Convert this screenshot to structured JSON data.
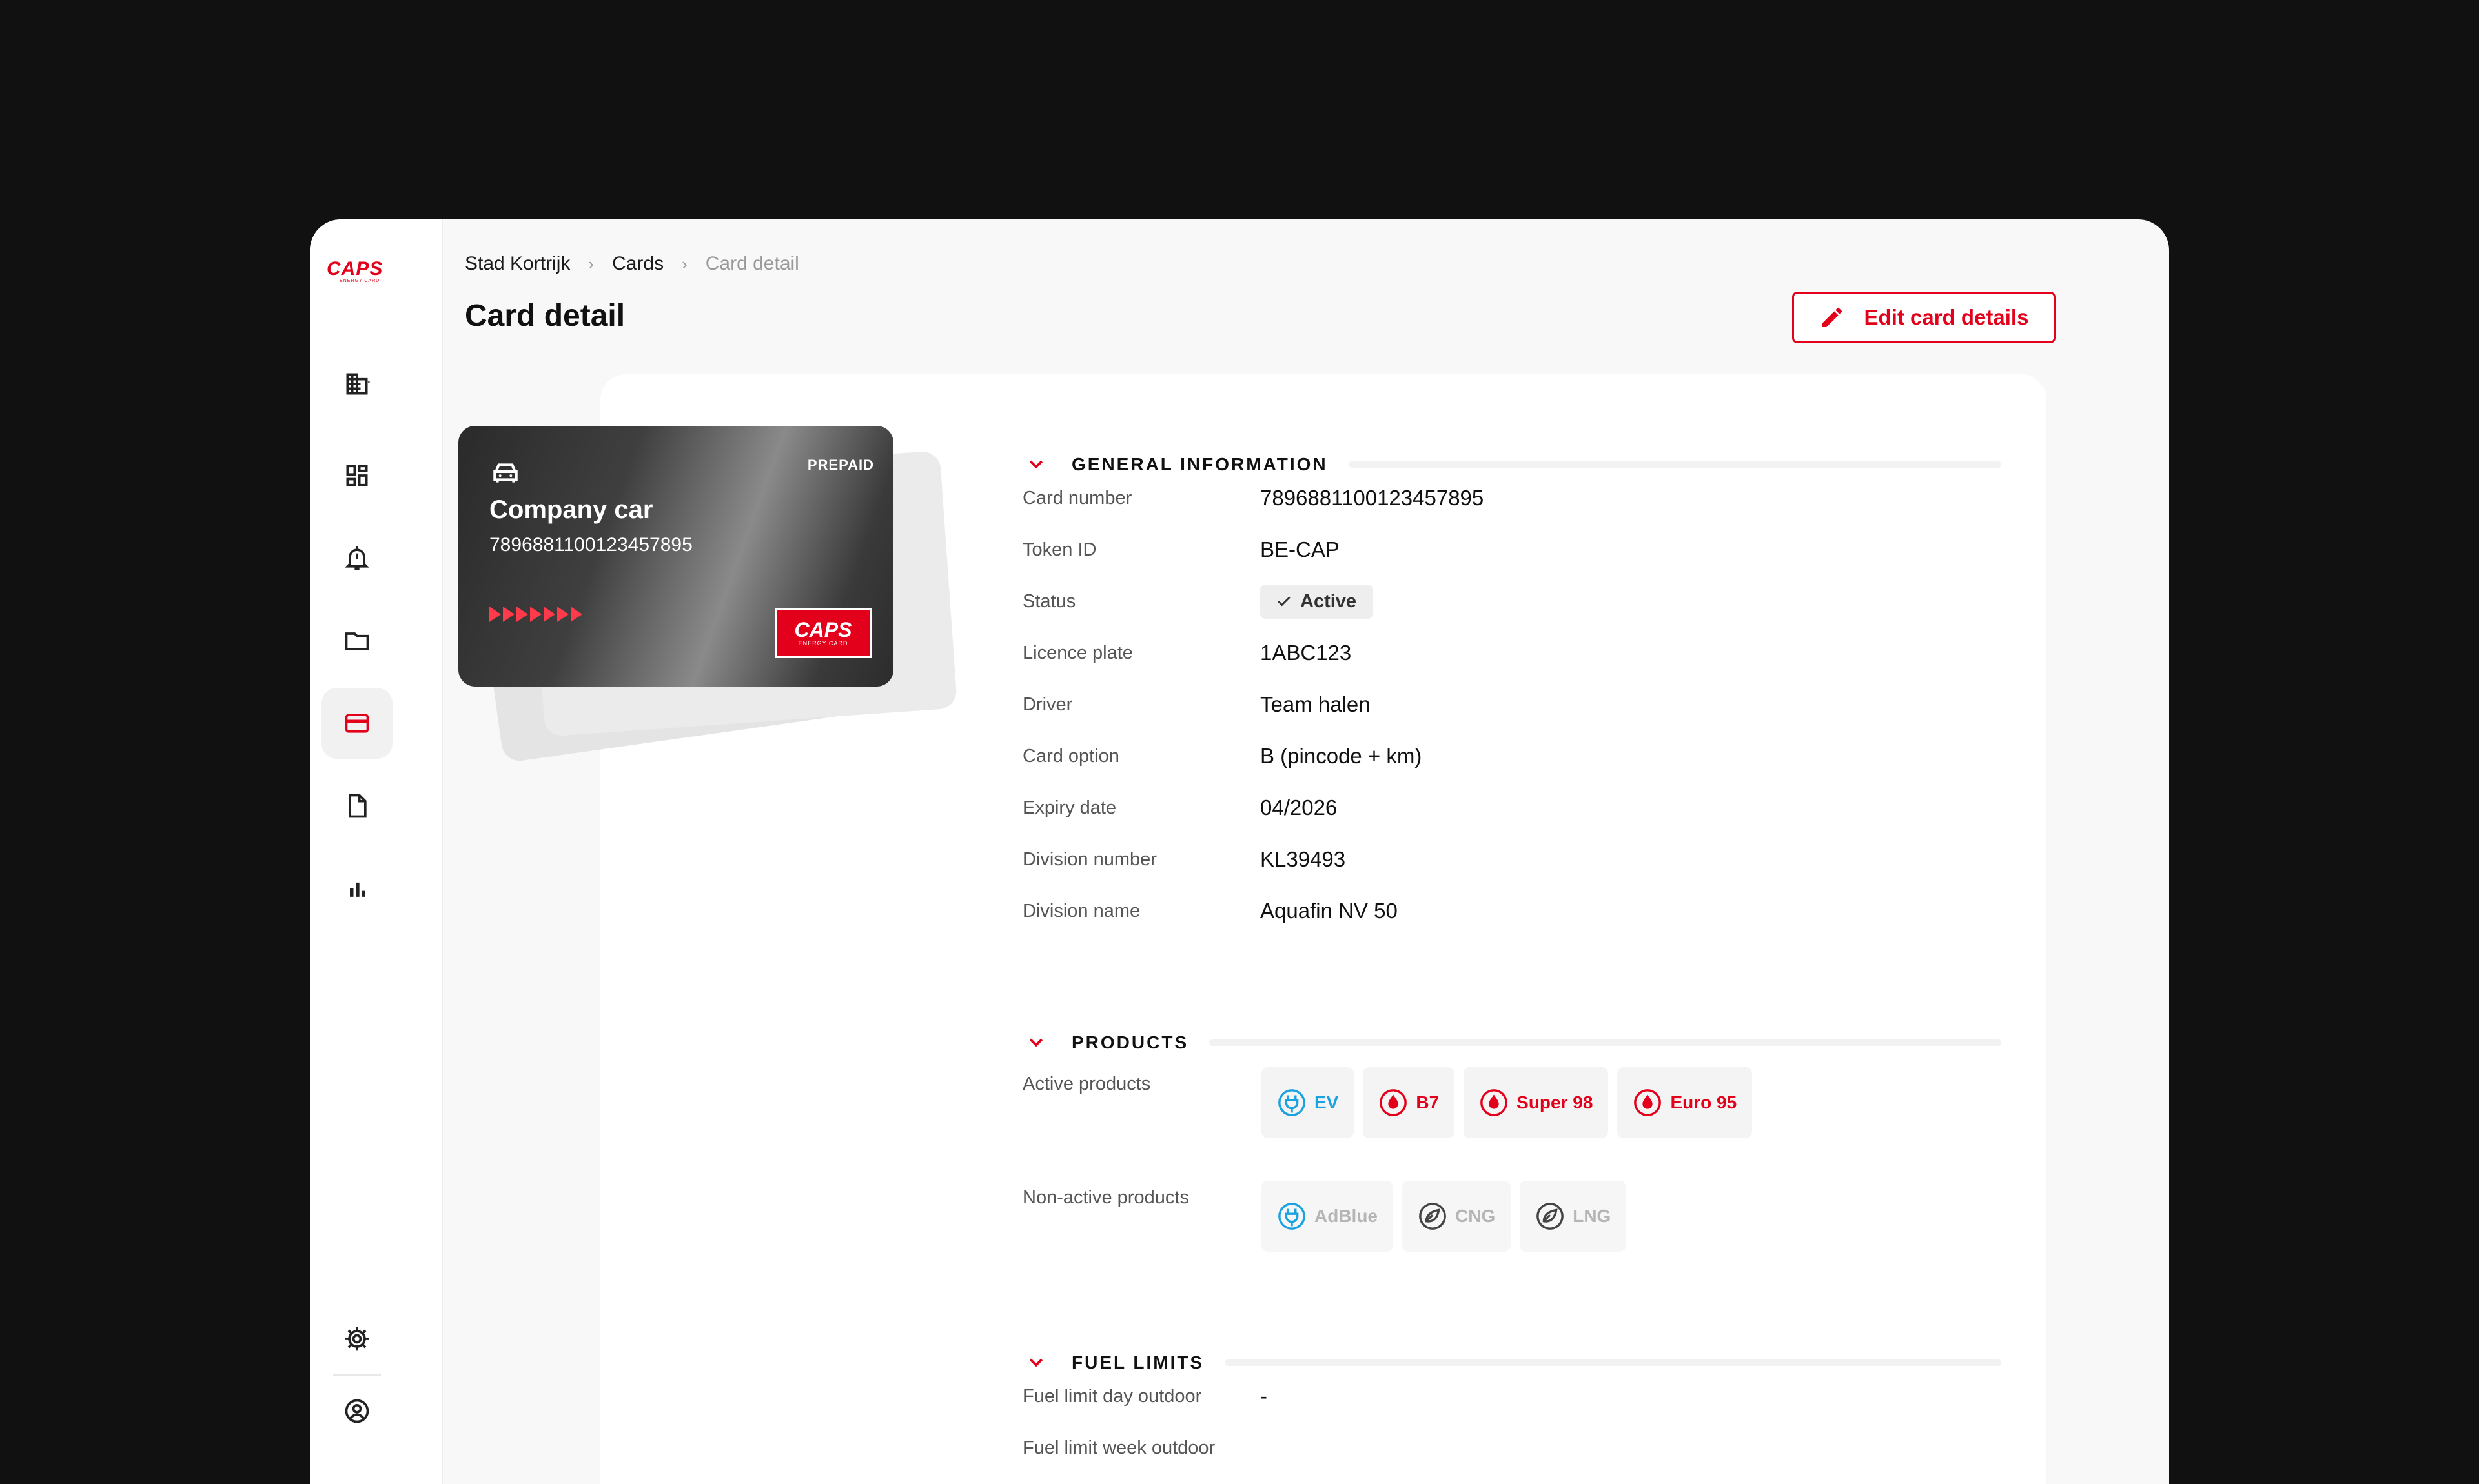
{
  "brand": {
    "logo_text": "CAPS",
    "logo_sub": "ENERGY CARD",
    "accent": "#e3001b"
  },
  "sidebar": {
    "items": [
      {
        "name": "building-icon"
      },
      {
        "name": "dashboard-icon"
      },
      {
        "name": "alarm-icon"
      },
      {
        "name": "folder-icon"
      },
      {
        "name": "card-icon",
        "active": true
      },
      {
        "name": "document-icon"
      },
      {
        "name": "bar-chart-icon"
      },
      {
        "name": "gear-icon"
      },
      {
        "name": "user-icon"
      }
    ]
  },
  "breadcrumb": [
    "Stad Kortrijk",
    "Cards",
    "Card detail"
  ],
  "header": {
    "title": "Card detail",
    "edit_label": "Edit card details"
  },
  "card": {
    "type_label": "PREPAID",
    "name": "Company car",
    "number": "7896881100123457895",
    "logo_text": "CAPS",
    "logo_sub": "ENERGY CARD"
  },
  "general": {
    "title": "GENERAL INFORMATION",
    "rows": [
      {
        "label": "Card number",
        "value": "7896881100123457895"
      },
      {
        "label": "Token ID",
        "value": "BE-CAP"
      },
      {
        "label": "Status",
        "value": "Active"
      },
      {
        "label": "Licence plate",
        "value": "1ABC123"
      },
      {
        "label": "Driver",
        "value": "Team halen"
      },
      {
        "label": "Card option",
        "value": "B (pincode + km)"
      },
      {
        "label": "Expiry date",
        "value": "04/2026"
      },
      {
        "label": "Division number",
        "value": "KL39493"
      },
      {
        "label": "Division name",
        "value": "Aquafin NV 50"
      }
    ]
  },
  "products": {
    "title": "PRODUCTS",
    "active_label": "Active products",
    "active": [
      {
        "label": "EV",
        "icon": "ev-plug-icon",
        "color": "#1aa3e0"
      },
      {
        "label": "B7",
        "icon": "fuel-drop-icon",
        "color": "#e3001b"
      },
      {
        "label": "Super 98",
        "icon": "fuel-drop-icon",
        "color": "#e3001b"
      },
      {
        "label": "Euro 95",
        "icon": "fuel-drop-icon",
        "color": "#e3001b"
      }
    ],
    "inactive_label": "Non-active products",
    "inactive": [
      {
        "label": "AdBlue",
        "icon": "ev-plug-icon"
      },
      {
        "label": "CNG",
        "icon": "gas-icon"
      },
      {
        "label": "LNG",
        "icon": "gas-icon"
      }
    ]
  },
  "fuel_limits": {
    "title": "FUEL LIMITS",
    "rows": [
      {
        "label": "Fuel limit day outdoor",
        "value": "-"
      },
      {
        "label": "Fuel limit week outdoor",
        "value": ""
      }
    ]
  }
}
